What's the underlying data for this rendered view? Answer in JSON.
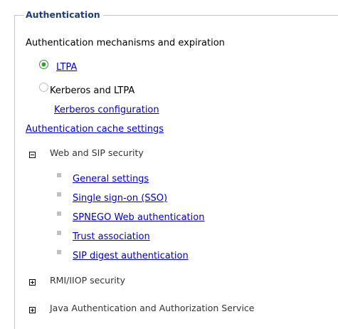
{
  "section": {
    "title": "Authentication"
  },
  "mechanisms": {
    "heading": "Authentication mechanisms and expiration",
    "ltpa_label": "LTPA",
    "kerberos_label": "Kerberos and LTPA",
    "kerberos_config_link": "Kerberos configuration",
    "selected": "LTPA"
  },
  "cache_link": "Authentication cache settings",
  "web_sip": {
    "label": "Web and SIP security",
    "expanded": true,
    "items": [
      "General settings",
      "Single sign-on (SSO)",
      "SPNEGO Web authentication",
      "Trust association",
      "SIP digest authentication"
    ]
  },
  "rmi": {
    "label": "RMI/IIOP security",
    "expanded": false
  },
  "jaas": {
    "label": "Java Authentication and Authorization Service",
    "expanded": false
  }
}
